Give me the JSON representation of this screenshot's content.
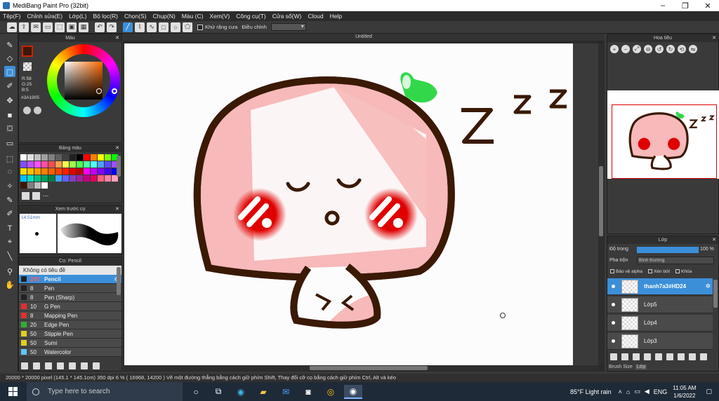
{
  "window": {
    "title": "MediBang Paint Pro (32bit)"
  },
  "menu": [
    "Tệp(F)",
    "Chỉnh sửa(E)",
    "Lớp(L)",
    "Bộ lọc(R)",
    "Chọn(S)",
    "Chụp(N)",
    "Màu (C)",
    "Xem(V)",
    "Công cụ(T)",
    "Cửa sổ(W)",
    "Cloud",
    "Help"
  ],
  "toolbar": {
    "antialias_label": "Khử răng cưa",
    "adjust_label": "Điều chỉnh"
  },
  "color_panel": {
    "title": "Màu",
    "r": "R:58",
    "g": "G:25",
    "b": "B:5",
    "hex": "#3A1905",
    "fg_color": "#3A1905"
  },
  "palette_panel": {
    "title": "Bảng màu",
    "footer": "---",
    "colors": [
      "#ffffff",
      "#e0e0e0",
      "#c0c0c0",
      "#a0a0a0",
      "#808080",
      "#606060",
      "#404040",
      "#202020",
      "#000000",
      "#ff0000",
      "#ff8000",
      "#ffff00",
      "#80ff00",
      "#00ff00",
      "#7f4fff",
      "#c04fff",
      "#ff4fff",
      "#ff4f9f",
      "#ff4f4f",
      "#ff9f4f",
      "#ffff4f",
      "#9fff4f",
      "#4fff4f",
      "#4fff9f",
      "#4fffff",
      "#4f9fff",
      "#4f4fff",
      "#9f4fff",
      "#ffe000",
      "#ffc000",
      "#ffa000",
      "#ff8000",
      "#ff6000",
      "#ff4000",
      "#ff2000",
      "#e00000",
      "#c00000",
      "#ff00ff",
      "#c000ff",
      "#8000ff",
      "#4000ff",
      "#0000ff",
      "#00c0ff",
      "#00e0c0",
      "#00c080",
      "#00a060",
      "#008040",
      "#40a0ff",
      "#6060ff",
      "#8040c0",
      "#a020a0",
      "#c00080",
      "#e00060",
      "#ff6080",
      "#ff80a0",
      "#ffa0c0",
      "#3a1905",
      "#808080",
      "#c0c0c0",
      "#ffffff"
    ]
  },
  "preview_panel": {
    "title": "Xem trước cọ",
    "size": "14.51mm"
  },
  "brush_panel": {
    "title": "Cọ: Pencil",
    "group": "Không có tiêu đề",
    "brushes": [
      {
        "size": "200",
        "name": "Pencil",
        "color": "#222222",
        "selected": true
      },
      {
        "size": "8",
        "name": "Pen",
        "color": "#222222"
      },
      {
        "size": "8",
        "name": "Pen (Sharp)",
        "color": "#222222"
      },
      {
        "size": "10",
        "name": "G Pen",
        "color": "#e03030"
      },
      {
        "size": "8",
        "name": "Mapping Pen",
        "color": "#e03030"
      },
      {
        "size": "20",
        "name": "Edge Pen",
        "color": "#30b030"
      },
      {
        "size": "50",
        "name": "Stipple Pen",
        "color": "#e0d020"
      },
      {
        "size": "50",
        "name": "Sumi",
        "color": "#e0d020"
      },
      {
        "size": "50",
        "name": "Watercolor",
        "color": "#5bc8ff"
      }
    ]
  },
  "canvas": {
    "title": "Untitled"
  },
  "navigator": {
    "title": "Hoa tiêu"
  },
  "layer_panel": {
    "title": "Lớp",
    "opacity_label": "Độ trong",
    "opacity_value": "100 %",
    "opacity": 1.0,
    "blend_label": "Pha trộn",
    "blend_value": "Bình thường",
    "protect_alpha": "Bảo vệ alpha",
    "clipping": "Xén bớt",
    "lock": "Khóa",
    "layers": [
      {
        "name": "thanh7a3#HD24",
        "selected": true
      },
      {
        "name": "Lớp5"
      },
      {
        "name": "Lớp4"
      },
      {
        "name": "Lớp3"
      }
    ],
    "bottom_tabs": [
      "Brush Size",
      "Lớp"
    ]
  },
  "status_bar": {
    "text": "20000 * 20000 pixel   (145.1 * 145.1cm)   350 dpi   6 %   ( 16968, 14200 )   Vẽ một đường thẳng bằng cách giữ phím Shift, Thay đổi cỡ cọ bằng cách giữ phím Ctrl, Alt và kéo"
  },
  "taskbar": {
    "search_placeholder": "Type here to search",
    "weather": "85°F  Light rain",
    "lang": "ENG",
    "time": "11:05 AM",
    "date": "1/6/2022"
  },
  "colors": {
    "accent": "#3b8fd9",
    "cheek": "#e00000",
    "face_pink": "#f7b9b9",
    "outline": "#3a1905",
    "leaf": "#33d84a"
  }
}
